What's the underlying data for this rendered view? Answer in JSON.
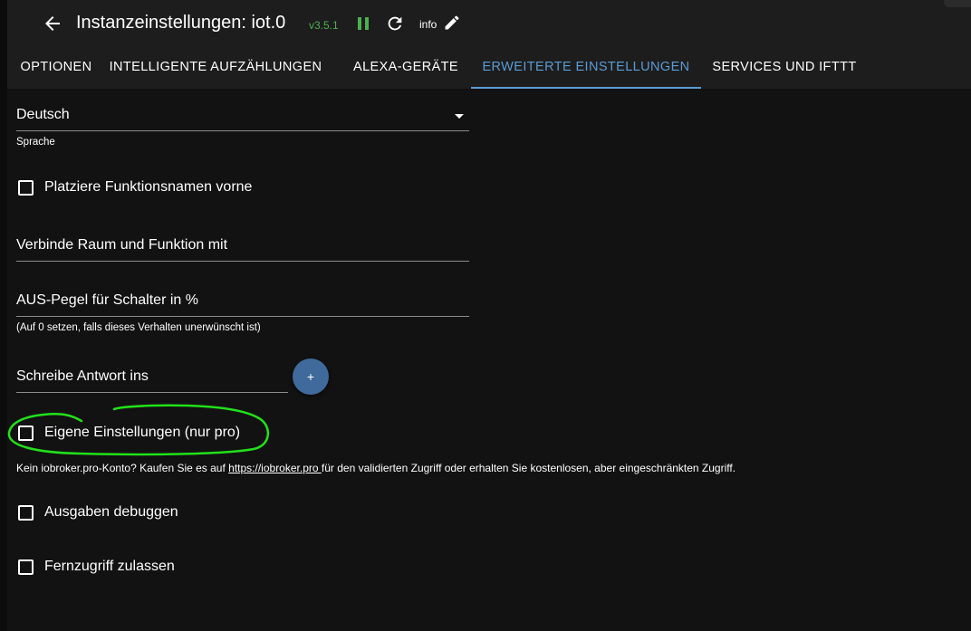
{
  "header": {
    "title": "Instanzeinstellungen: iot.0",
    "version": "v3.5.1",
    "info_label": "info"
  },
  "tabs": [
    {
      "label": "OPTIONEN",
      "active": false
    },
    {
      "label": "INTELLIGENTE AUFZÄHLUNGEN",
      "active": false
    },
    {
      "label": "ALEXA-GERÄTE",
      "active": false
    },
    {
      "label": "ERWEITERTE EINSTELLUNGEN",
      "active": true
    },
    {
      "label": "SERVICES UND IFTTT",
      "active": false
    }
  ],
  "form": {
    "language": {
      "value": "Deutsch",
      "helper": "Sprache"
    },
    "function_first": {
      "label": "Platziere Funktionsnamen vorne",
      "checked": false
    },
    "concatenate": {
      "value": "Verbinde Raum und Funktion mit"
    },
    "off_level": {
      "value": "AUS-Pegel für Schalter in %",
      "helper": "(Auf 0 setzen, falls dieses Verhalten unerwünscht ist)"
    },
    "response": {
      "value": "Schreibe Antwort ins",
      "add_label": "+"
    },
    "custom_settings": {
      "label": "Eigene Einstellungen (nur pro)",
      "checked": false
    },
    "pro_note": {
      "before": "Kein iobroker.pro-Konto? Kaufen Sie es auf ",
      "link": "https://iobroker.pro ",
      "after": "für den validierten Zugriff oder erhalten Sie kostenlosen, aber eingeschränkten Zugriff."
    },
    "debug": {
      "label": "Ausgaben debuggen",
      "checked": false
    },
    "remote": {
      "label": "Fernzugriff zulassen",
      "checked": false
    }
  },
  "colors": {
    "accent": "#5b9bd5",
    "version_green": "#4caf50",
    "annotation_green": "#22e01a",
    "fab": "#3f6a9b"
  }
}
